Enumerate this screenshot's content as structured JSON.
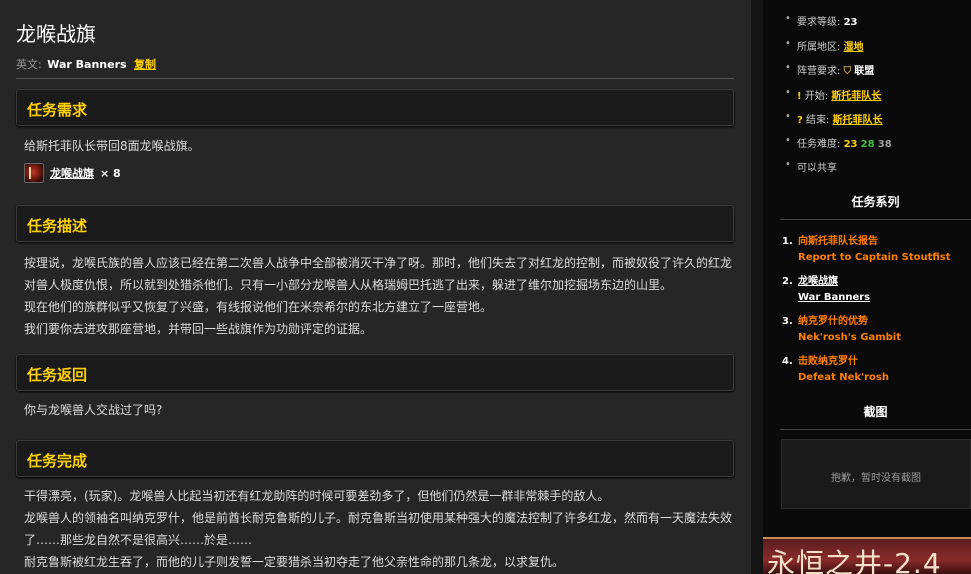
{
  "quest": {
    "title": "龙喉战旗",
    "en_label": "英文:",
    "en_name": "War Banners",
    "copy_label": "复制"
  },
  "sections": {
    "objectives": {
      "heading": "任务需求",
      "text": "给斯托菲队长带回8面龙喉战旗。",
      "item_name": "龙喉战旗",
      "item_count": "× 8"
    },
    "description": {
      "heading": "任务描述",
      "lines": [
        "按理说，龙喉氏族的兽人应该已经在第二次兽人战争中全部被消灭干净了呀。那时，他们失去了对红龙的控制，而被奴役了许久的红龙",
        "对兽人极度仇恨，所以就到处猎杀他们。只有一小部分龙喉兽人从格瑞姆巴托逃了出来，躲进了维尔加挖掘场东边的山里。",
        "现在他们的族群似乎又恢复了兴盛，有线报说他们在米奈希尔的东北方建立了一座营地。",
        "我们要你去进攻那座营地，并带回一些战旗作为功勋评定的证据。"
      ]
    },
    "progress": {
      "heading": "任务返回",
      "text": "你与龙喉兽人交战过了吗?"
    },
    "completion": {
      "heading": "任务完成",
      "lines": [
        "干得漂亮，(玩家)。龙喉兽人比起当初还有红龙助阵的时候可要差劲多了，但他们仍然是一群非常棘手的敌人。",
        "龙喉兽人的领袖名叫纳克罗什，他是前酋长耐克鲁斯的儿子。耐克鲁斯当初使用某种强大的魔法控制了许多红龙，然而有一天魔法失效",
        "了……那些龙自然不是很高兴……於是……",
        "耐克鲁斯被红龙生吞了，而他的儿子则发誓一定要猎杀当初夺走了他父亲性命的那几条龙，以求复仇。"
      ]
    }
  },
  "sidebar": {
    "info": {
      "level_label": "要求等级:",
      "level_value": "23",
      "zone_label": "所属地区:",
      "zone_value": "湿地",
      "faction_label": "阵营要求:",
      "faction_value": "联盟",
      "start_label": "开始:",
      "start_value": "斯托菲队长",
      "end_label": "结束:",
      "end_value": "斯托菲队长",
      "difficulty_label": "任务难度:",
      "difficulty_values": [
        "23",
        "28",
        "38"
      ],
      "shareable": "可以共享"
    },
    "series": {
      "heading": "任务系列",
      "items": [
        {
          "num": "1.",
          "cn": "向斯托菲队长报告",
          "en": "Report to Captain Stoutfist"
        },
        {
          "num": "2.",
          "cn": "龙喉战旗",
          "en": "War Banners"
        },
        {
          "num": "3.",
          "cn": "纳克罗什的优势",
          "en": "Nek'rosh's Gambit"
        },
        {
          "num": "4.",
          "cn": "击败纳克罗什",
          "en": "Defeat Nek'rosh"
        }
      ]
    },
    "screenshots": {
      "heading": "截图",
      "empty_text": "抱歉，暂时没有截图"
    },
    "banner_text": "永恒之井-2.4"
  },
  "colors": {
    "accent": "#ffd100",
    "series": "#ff8000",
    "easy": "#40bf40",
    "grey": "#9d9d9d"
  }
}
